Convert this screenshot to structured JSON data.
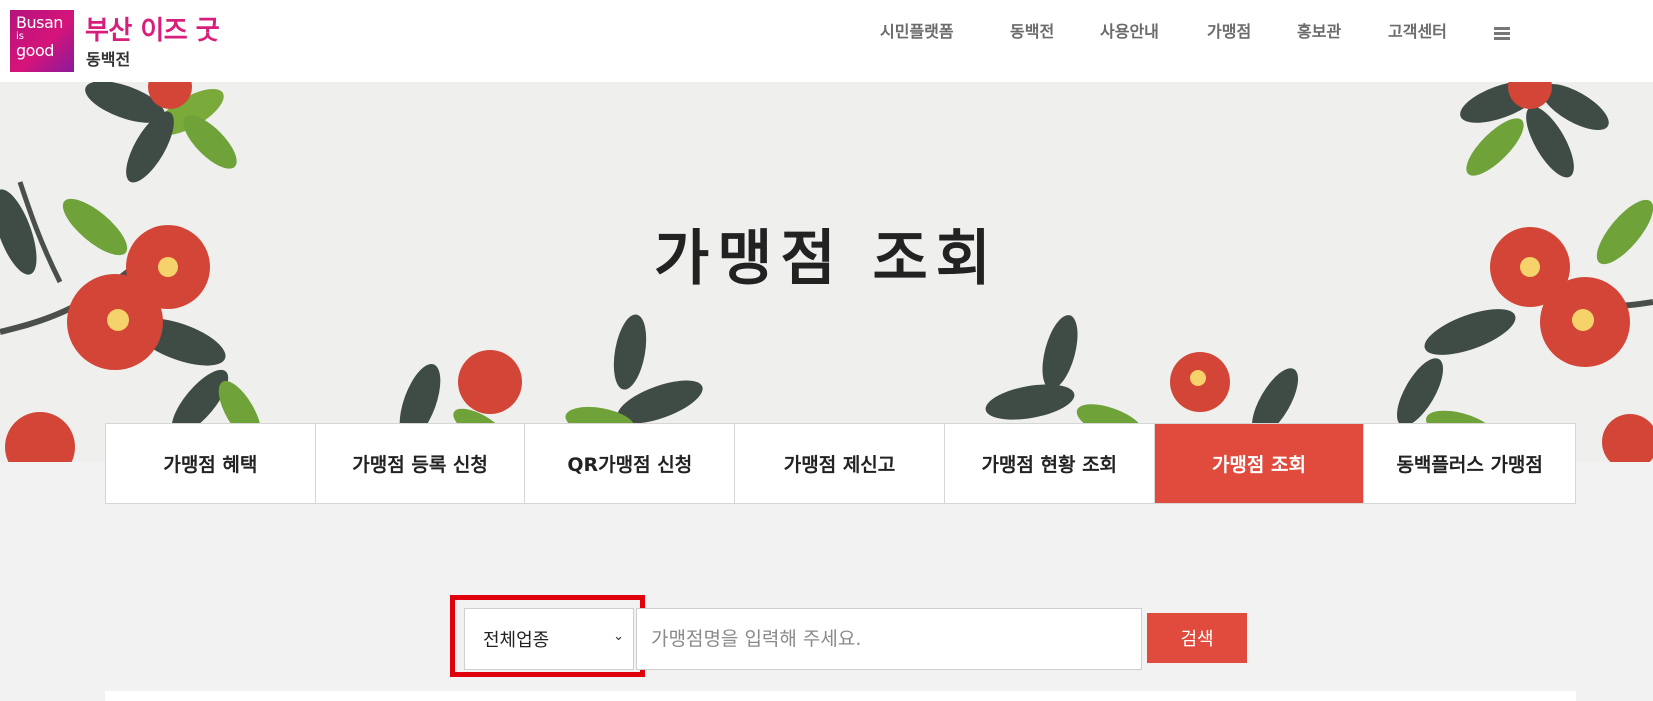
{
  "header": {
    "logo": {
      "line1": "Busan",
      "line2": "is",
      "line3": "good"
    },
    "brand_title": "부산 이즈 굿",
    "brand_sub": "동백전",
    "nav": [
      "시민플랫폼",
      "동백전",
      "사용안내",
      "가맹점",
      "홍보관",
      "고객센터"
    ],
    "menu_icon": "hamburger-icon"
  },
  "hero": {
    "title": "가맹점 조회"
  },
  "tabs": [
    {
      "label": "가맹점 혜택",
      "active": false
    },
    {
      "label": "가맹점 등록 신청",
      "active": false
    },
    {
      "label": "QR가맹점 신청",
      "active": false
    },
    {
      "label": "가맹점 제신고",
      "active": false
    },
    {
      "label": "가맹점 현황 조회",
      "active": false
    },
    {
      "label": "가맹점 조회",
      "active": true
    },
    {
      "label": "동백플러스 가맹점",
      "active": false
    }
  ],
  "search": {
    "category_selected": "전체업종",
    "placeholder": "가맹점명을 입력해 주세요.",
    "button_label": "검색"
  },
  "colors": {
    "accent": "#e04b3e",
    "brand": "#d81e7b",
    "highlight": "#e0000b"
  }
}
